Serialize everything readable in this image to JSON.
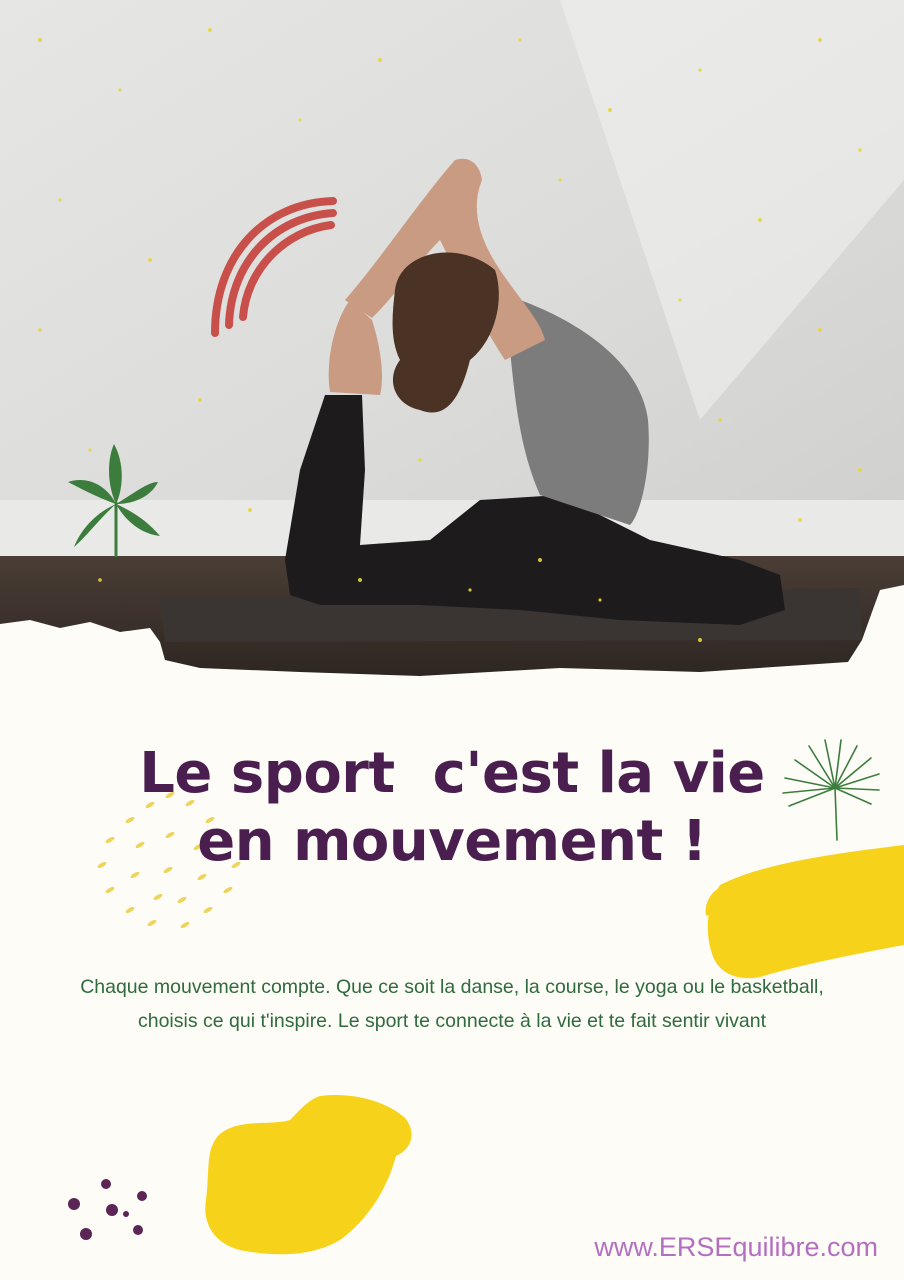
{
  "headline": {
    "line1": "Le sport  c'est la vie",
    "line2": "en mouvement !"
  },
  "body": "Chaque mouvement compte. Que ce soit la danse, la course, le yoga ou le basketball, choisis ce qui t'inspire. Le sport te connecte à la vie et te fait sentir vivant",
  "website": "www.ERSEquilibre.com",
  "colors": {
    "headline": "#4a1f4f",
    "body": "#2f6b3e",
    "website": "#b46fc0",
    "yellow_accent": "#f7d21a",
    "red_arc": "#c9504a",
    "leaf_green": "#3c7d3e",
    "dots": "#5b2556"
  },
  "icons": [
    "red-arc-icon",
    "green-leaf-icon",
    "palm-leaf-icon",
    "yellow-dot-circle-icon",
    "yellow-brush-stroke-icon",
    "purple-dots-icon"
  ]
}
